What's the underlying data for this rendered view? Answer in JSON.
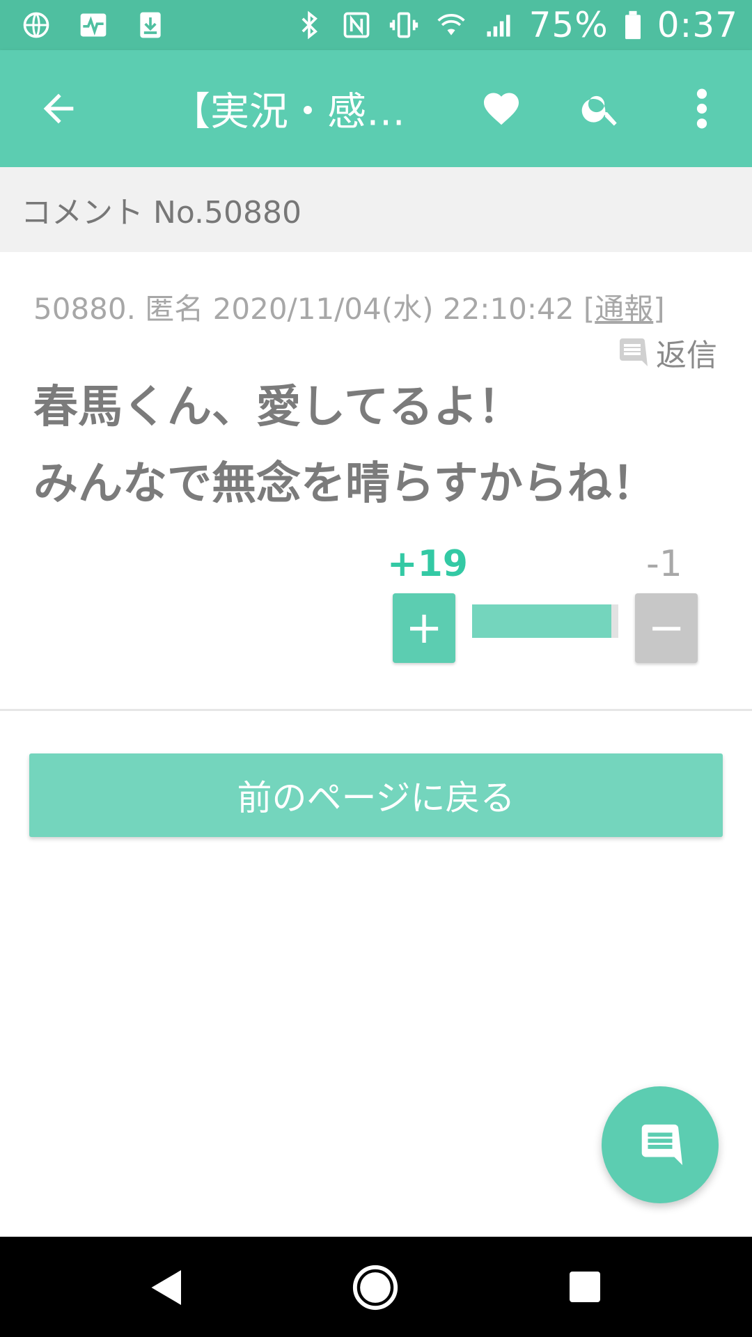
{
  "status_bar": {
    "battery": "75%",
    "time": "0:37"
  },
  "app_bar": {
    "title": "【実況・感想…"
  },
  "subheader": {
    "text": "コメント No.50880"
  },
  "comment": {
    "meta_prefix": "50880. 匿名 2020/11/04(水) 22:10:42 [",
    "report_label": "通報",
    "meta_suffix": "]",
    "reply_label": "返信",
    "body_line1": "春馬くん、愛してるよ！",
    "body_line2": "みんなで無念を晴らすからね！",
    "plus_count": "+19",
    "minus_count": "-1",
    "plus_label": "+",
    "minus_label": "−",
    "plus_ratio": 0.95
  },
  "back_button": {
    "label": "前のページに戻る"
  },
  "colors": {
    "accent": "#5ccdb1",
    "accent_light": "#74d5bd",
    "status_bar": "#4fbfa0",
    "plus_text": "#33c9a4"
  }
}
